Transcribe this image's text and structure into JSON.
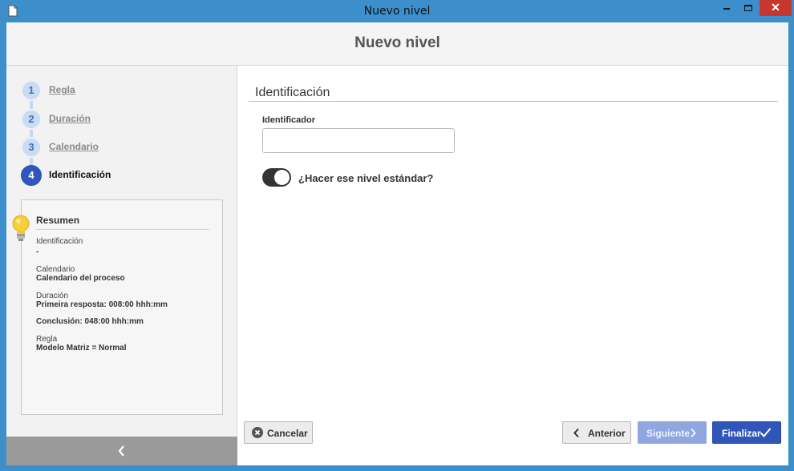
{
  "window": {
    "title": "Nuevo nivel",
    "close_glyph": "✕"
  },
  "header": {
    "title": "Nuevo nivel"
  },
  "steps": [
    {
      "number": "1",
      "label": "Regla"
    },
    {
      "number": "2",
      "label": "Duración"
    },
    {
      "number": "3",
      "label": "Calendario"
    },
    {
      "number": "4",
      "label": "Identificación",
      "active": true
    }
  ],
  "summary": {
    "title": "Resumen",
    "identificacion_label": "Identificación",
    "identificacion_value": "-",
    "calendario_label": "Calendario",
    "calendario_value": "Calendario del proceso",
    "duracion_label": "Duración",
    "duracion_value_1": "Primeira resposta: 008:00 hhh:mm",
    "duracion_value_2": "Conclusión: 048:00 hhh:mm",
    "regla_label": "Regla",
    "regla_value": "Modelo Matriz = Normal"
  },
  "form": {
    "section_title": "Identificación",
    "identificador_label": "Identificador",
    "identificador_value": "",
    "standard_toggle_label": "¿Hacer ese nivel estándar?",
    "standard_toggle_on": true
  },
  "buttons": {
    "cancel": "Cancelar",
    "previous": "Anterior",
    "next": "Siguiente",
    "finish": "Finalizar"
  },
  "icons": [
    "document-icon",
    "minimize-icon",
    "maximize-icon",
    "close-icon",
    "lightbulb-icon",
    "chevron-left-icon",
    "cancel-circle-icon",
    "chevron-right-icon",
    "checkmark-icon"
  ],
  "colors": {
    "titlebar": "#3c8fcb",
    "accent": "#2f56b8",
    "next_disabled": "#8fa6df",
    "close": "#c7372f"
  }
}
